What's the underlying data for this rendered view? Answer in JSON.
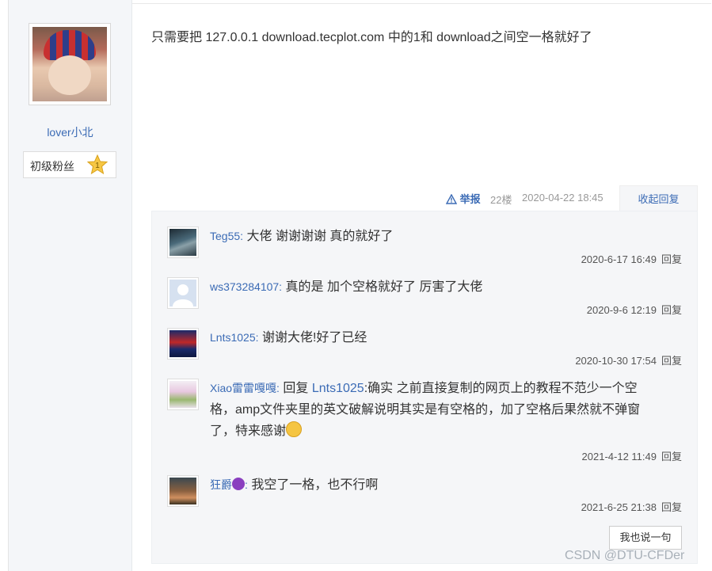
{
  "op": {
    "username": "lover小北",
    "level_badge": "初级粉丝",
    "level_number": "1"
  },
  "post": {
    "content": "只需要把 127.0.0.1 download.tecplot.com 中的1和 download之间空一格就好了",
    "report_label": "举报",
    "floor": "22楼",
    "time": "2020-04-22 18:45",
    "collapse_label": "收起回复"
  },
  "replies": [
    {
      "name": "Teg55:",
      "text": "大佬 谢谢谢谢 真的就好了",
      "time": "2020-6-17 16:49",
      "reply_label": "回复"
    },
    {
      "name": "ws373284107:",
      "text": "真的是 加个空格就好了 厉害了大佬",
      "time": "2020-9-6 12:19",
      "reply_label": "回复"
    },
    {
      "name": "Lnts1025:",
      "text": "谢谢大佬!好了已经",
      "time": "2020-10-30 17:54",
      "reply_label": "回复"
    },
    {
      "name": "Xiao雷雷嘎嘎:",
      "reply_prefix": "回复",
      "reply_to": "Lnts1025",
      "text": ":确实 之前直接复制的网页上的教程不范少一个空格，amp文件夹里的英文破解说明其实是有空格的，加了空格后果然就不弹窗了，特来感谢",
      "time": "2021-4-12 11:49",
      "reply_label": "回复"
    },
    {
      "name": "狂爵",
      "name_suffix": ":",
      "text": "我空了一格，也不行啊",
      "time": "2021-6-25 21:38",
      "reply_label": "回复"
    }
  ],
  "say_button": "我也说一句",
  "watermark": "CSDN @DTU-CFDer"
}
